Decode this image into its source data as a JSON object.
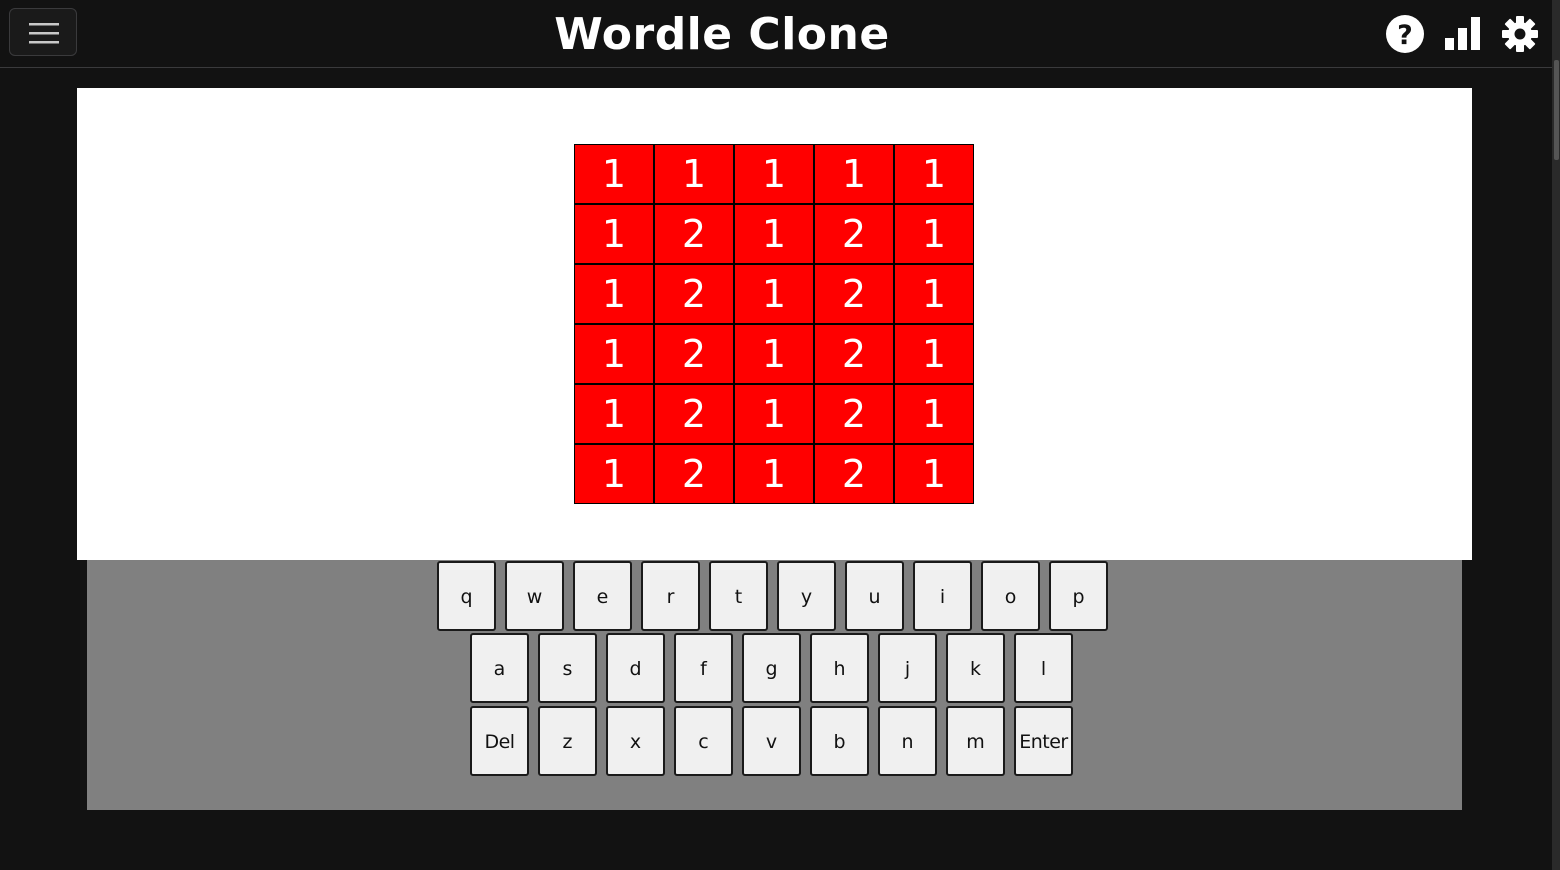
{
  "header": {
    "title": "Wordle Clone",
    "icons": [
      "menu-icon",
      "help-icon",
      "stats-icon",
      "settings-icon"
    ]
  },
  "colors": {
    "background": "#121212",
    "tile": "#ff0000",
    "tile_text": "#ffffff",
    "board_bg": "#ffffff",
    "keyboard_bg": "#808080",
    "key_bg": "#f0f0f0"
  },
  "grid": {
    "rows": [
      [
        "1",
        "1",
        "1",
        "1",
        "1"
      ],
      [
        "1",
        "2",
        "1",
        "2",
        "1"
      ],
      [
        "1",
        "2",
        "1",
        "2",
        "1"
      ],
      [
        "1",
        "2",
        "1",
        "2",
        "1"
      ],
      [
        "1",
        "2",
        "1",
        "2",
        "1"
      ],
      [
        "1",
        "2",
        "1",
        "2",
        "1"
      ]
    ]
  },
  "keyboard": {
    "rows": [
      [
        "q",
        "w",
        "e",
        "r",
        "t",
        "y",
        "u",
        "i",
        "o",
        "p"
      ],
      [
        "a",
        "s",
        "d",
        "f",
        "g",
        "h",
        "j",
        "k",
        "l"
      ],
      [
        "Del",
        "z",
        "x",
        "c",
        "v",
        "b",
        "n",
        "m",
        "Enter"
      ]
    ]
  }
}
